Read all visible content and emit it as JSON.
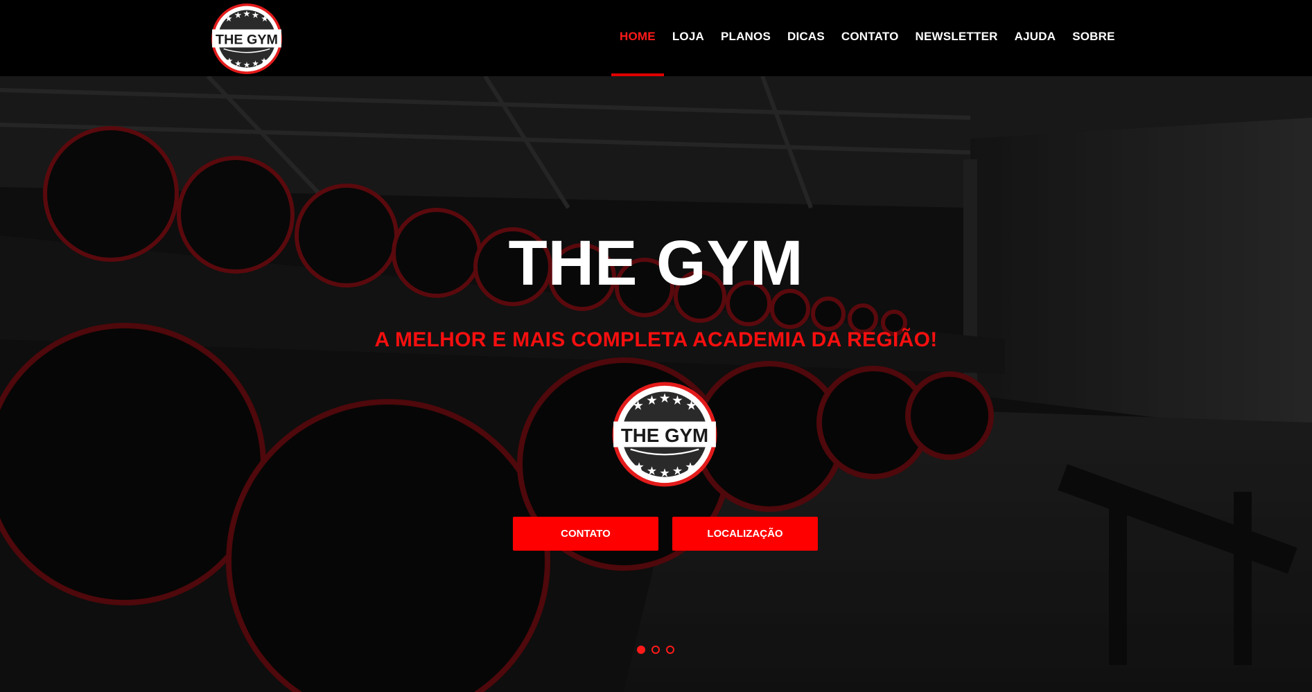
{
  "header": {
    "logo_text": "THE GYM",
    "nav": [
      {
        "label": "HOME",
        "active": true
      },
      {
        "label": "LOJA",
        "active": false
      },
      {
        "label": "PLANOS",
        "active": false
      },
      {
        "label": "DICAS",
        "active": false
      },
      {
        "label": "CONTATO",
        "active": false
      },
      {
        "label": "NEWSLETTER",
        "active": false
      },
      {
        "label": "AJUDA",
        "active": false
      },
      {
        "label": "SOBRE",
        "active": false
      }
    ]
  },
  "hero": {
    "title": "THE GYM",
    "subtitle": "A MELHOR E MAIS COMPLETA ACADEMIA DA REGIÃO!",
    "logo_text": "THE GYM",
    "buttons": {
      "contact": "CONTATO",
      "location": "LOCALIZAÇÃO"
    },
    "slides": {
      "count": 3,
      "active_index": 0
    }
  },
  "colors": {
    "accent": "#ff0000",
    "nav_active": "#ff1a1a",
    "subtitle": "#f50f0f",
    "header_bg": "#000000"
  }
}
